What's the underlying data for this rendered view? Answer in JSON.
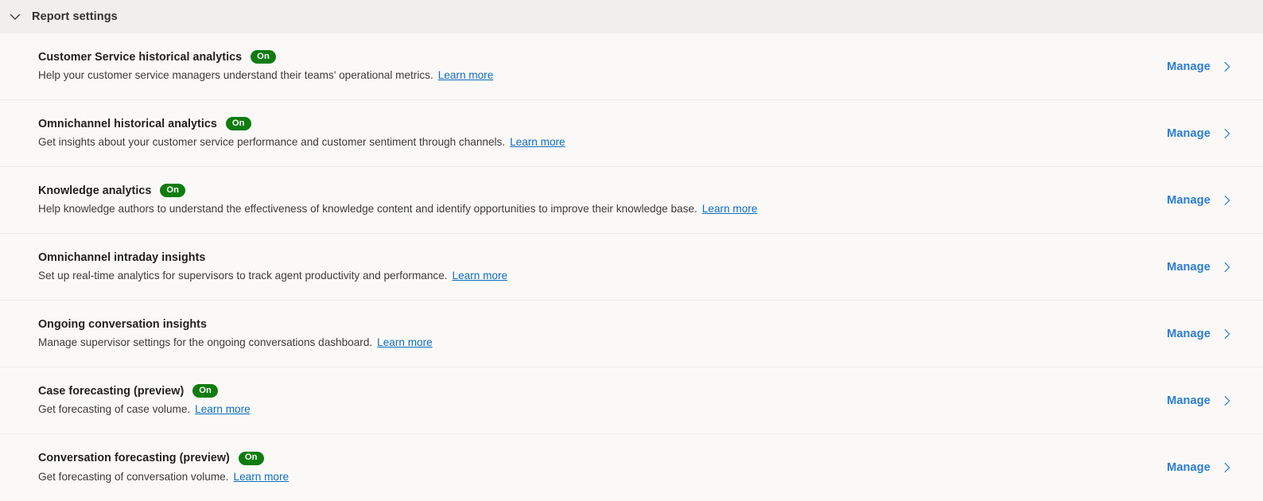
{
  "section": {
    "title": "Report settings",
    "expanded": true,
    "collapse_icon": "chevron-down-icon"
  },
  "colors": {
    "badge_on_background": "#107c10",
    "badge_on_text": "#ffffff",
    "link": "#0f6cbd",
    "manage_link": "#2b7cd3",
    "header_background": "#f0efee",
    "page_background": "#faf9f8",
    "row_divider": "#edebe9",
    "title_text": "#201f1e",
    "description_text": "#3b3a39"
  },
  "common": {
    "manage_label": "Manage",
    "manage_icon": "chevron-right-icon",
    "learn_more_label": "Learn more"
  },
  "rows": [
    {
      "title": "Customer Service historical analytics",
      "badge": "On",
      "description": "Help your customer service managers understand their teams' operational metrics.",
      "learn_more": "Learn more",
      "action": "Manage"
    },
    {
      "title": "Omnichannel historical analytics",
      "badge": "On",
      "description": "Get insights about your customer service performance and customer sentiment through channels.",
      "learn_more": "Learn more",
      "action": "Manage"
    },
    {
      "title": "Knowledge analytics",
      "badge": "On",
      "description": "Help knowledge authors to understand the effectiveness of knowledge content and identify opportunities to improve their knowledge base.",
      "learn_more": "Learn more",
      "action": "Manage"
    },
    {
      "title": "Omnichannel intraday insights",
      "badge": "",
      "description": "Set up real-time analytics for supervisors to track agent productivity and performance.",
      "learn_more": "Learn more",
      "action": "Manage"
    },
    {
      "title": "Ongoing conversation insights",
      "badge": "",
      "description": "Manage supervisor settings for the ongoing conversations dashboard.",
      "learn_more": "Learn more",
      "action": "Manage"
    },
    {
      "title": "Case forecasting (preview)",
      "badge": "On",
      "description": "Get forecasting of case volume.",
      "learn_more": "Learn more",
      "action": "Manage"
    },
    {
      "title": "Conversation forecasting (preview)",
      "badge": "On",
      "description": "Get forecasting of conversation volume.",
      "learn_more": "Learn more",
      "action": "Manage"
    }
  ]
}
